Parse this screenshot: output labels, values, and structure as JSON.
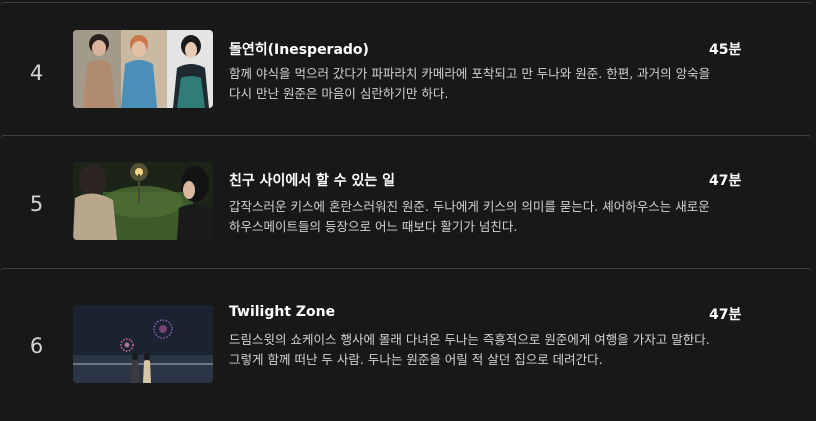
{
  "episodes": [
    {
      "index": "4",
      "title": "돌연히(Inesperado)",
      "duration": "45분",
      "synopsis": "함께 야식을 먹으러 갔다가 파파라치 카메라에 포착되고 만 두나와 원준. 한편, 과거의 앙숙을 다시 만난 원준은 마음이 심란하기만 하다."
    },
    {
      "index": "5",
      "title": "친구 사이에서 할 수 있는 일",
      "duration": "47분",
      "synopsis": "갑작스러운 키스에 혼란스러워진 원준. 두나에게 키스의 의미를 묻는다. 셰어하우스는 새로운 하우스메이트들의 등장으로 어느 때보다 활기가 넘친다."
    },
    {
      "index": "6",
      "title": "Twilight Zone",
      "duration": "47분",
      "synopsis": "드림스윗의 쇼케이스 행사에 몰래 다녀온 두나는 즉흥적으로 원준에게 여행을 가자고 말한다. 그렇게 함께 떠난 두 사람. 두나는 원준을 어릴 적 살던 집으로 데려간다."
    }
  ]
}
